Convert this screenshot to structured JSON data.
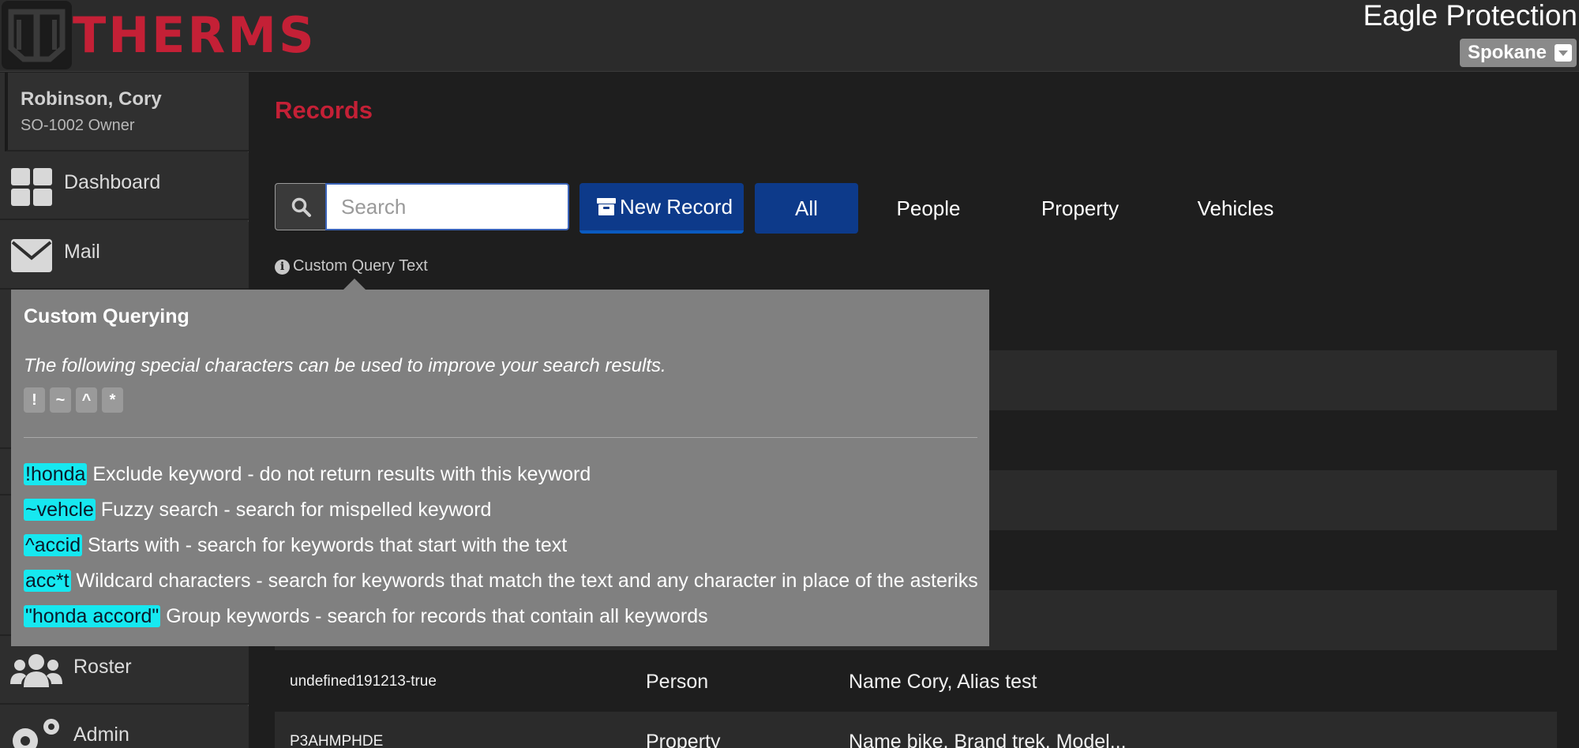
{
  "header": {
    "brand": "THERMS",
    "company": "Eagle Protection",
    "location": "Spokane"
  },
  "sidebar": {
    "user": {
      "name": "Robinson, Cory",
      "role": "SO-1002 Owner"
    },
    "items": [
      {
        "label": "Dashboard",
        "icon": "dashboard-icon"
      },
      {
        "label": "Mail",
        "icon": "mail-icon"
      },
      {
        "label": "Roster",
        "icon": "roster-icon"
      },
      {
        "label": "Admin",
        "icon": "gears-icon"
      }
    ]
  },
  "main": {
    "title": "Records",
    "search": {
      "placeholder": "Search",
      "value": ""
    },
    "new_record_label": "New Record",
    "tabs": [
      {
        "label": "All",
        "active": true
      },
      {
        "label": "People",
        "active": false
      },
      {
        "label": "Property",
        "active": false
      },
      {
        "label": "Vehicles",
        "active": false
      }
    ],
    "custom_query_link": "Custom Query Text",
    "rows": [
      {
        "id": "undefined191213-true",
        "type": "Person",
        "details": "Name Cory, Alias test"
      },
      {
        "id": "P3AHMPHDE",
        "type": "Property",
        "details": "Name bike, Brand trek, Model..."
      }
    ]
  },
  "popover": {
    "title": "Custom Querying",
    "description": "The following special characters can be used to improve your search results.",
    "special_chars": [
      "!",
      "~",
      "^",
      "*"
    ],
    "examples": [
      {
        "keyword": "!honda",
        "text": "Exclude keyword - do not return results with this keyword"
      },
      {
        "keyword": "~vehcle",
        "text": "Fuzzy search - search for mispelled keyword"
      },
      {
        "keyword": "^accid",
        "text": "Starts with - search for keywords that start with the text"
      },
      {
        "keyword": "acc*t",
        "text": "Wildcard characters - search for keywords that match the text and any character in place of the asteriks"
      },
      {
        "keyword": "\"honda accord\"",
        "text": "Group keywords - search for records that contain all keywords"
      }
    ]
  },
  "colors": {
    "brand_red": "#c42036",
    "primary_blue": "#0d3a8a",
    "keyword_highlight": "#16e8f0"
  }
}
